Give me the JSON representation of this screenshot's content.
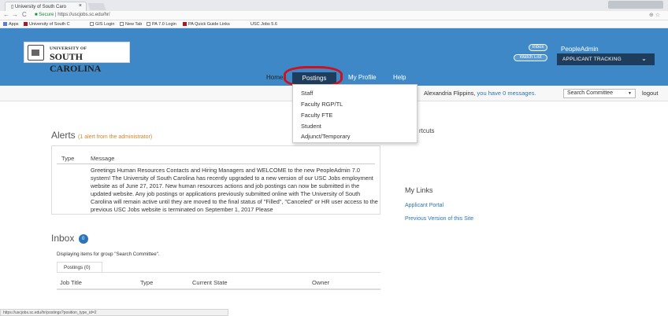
{
  "browser": {
    "tab_title": "University of South Caro",
    "tab_close": "×",
    "window_controls": "",
    "back": "←",
    "forward": "→",
    "reload": "C",
    "secure_label": "Secure",
    "url": "https://uscjobs.sc.edu/hr/",
    "zoom_icon": "⊕",
    "star_icon": "☆",
    "bookmarks": [
      "Apps",
      "University of South C",
      "GIS Login",
      "New Tab",
      "PA 7.0 Login",
      "PA Quick Guide Links",
      "USC Jobs 5.6"
    ],
    "status_url": "https://uscjobs.sc.edu/hr/postings?position_type_id=2"
  },
  "header": {
    "logo_line1": "UNIVERSITY OF",
    "logo_line2": "SOUTH CAROLINA",
    "inbox_btn": "Inbox",
    "watchlist_btn": "Watch List",
    "brand": "PeopleAdmin",
    "module": "APPLICANT TRACKING",
    "module_chevron": "⌄",
    "nav": {
      "home": "Home",
      "postings": "Postings",
      "profile": "My Profile",
      "help": "Help"
    },
    "accent": "#3f88c7",
    "dark": "#1e3c5b"
  },
  "userbar": {
    "name": "Alexandria Flippins,",
    "messages_link": "you have 0 messages.",
    "group": "Search Committee",
    "group_arrow": "▼",
    "logout": "logout"
  },
  "dropdown": {
    "items": [
      "Staff",
      "Faculty RGP/TL",
      "Faculty FTE",
      "Student",
      "Adjunct/Temporary"
    ]
  },
  "alerts": {
    "title": "Alerts",
    "count": "(1 alert from the administrator)",
    "col_type": "Type",
    "col_message": "Message",
    "message": "Greetings Human Resources Contacts and Hiring Managers and WELCOME to the new PeopleAdmin 7.0 system! The University of South Carolina has recently upgraded to a new version of our USC Jobs employment website as of June 27, 2017. New human resources actions and job postings can now be submitted in the updated website. Any job postings or applications previously submitted online with The University of South Carolina will remain active until they are moved to the final status of \"Filled\", \"Canceled\" or HR user access to the previous USC Jobs website is terminated on September 1, 2017 Please"
  },
  "sidebar": {
    "shortcuts": "rtcuts",
    "mylinks_title": "My Links",
    "links": [
      "Applicant Portal",
      "Previous Version of this Site"
    ]
  },
  "inbox": {
    "title": "Inbox",
    "badge": "0",
    "subtitle": "Displaying items for group \"Search Committee\".",
    "tab": "Postings (0)",
    "headers": [
      "Job Title",
      "Type",
      "Current State",
      "Owner"
    ]
  }
}
